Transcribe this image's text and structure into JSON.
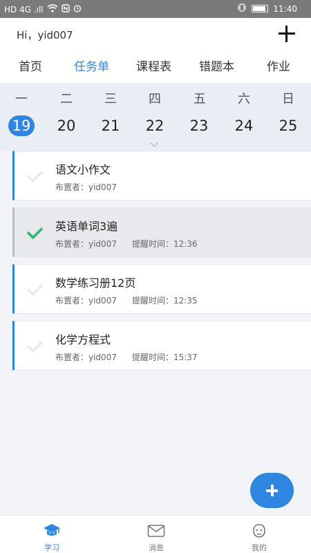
{
  "statusbar": {
    "left": "HD 4G .ıll",
    "time": "11:40"
  },
  "header": {
    "greeting": "Hi，yid007"
  },
  "tabs": [
    "首页",
    "任务单",
    "课程表",
    "错题本",
    "作业"
  ],
  "week": {
    "days": [
      "一",
      "二",
      "三",
      "四",
      "五",
      "六",
      "日"
    ],
    "dates": [
      "19",
      "20",
      "21",
      "22",
      "23",
      "24",
      "25"
    ],
    "selected_index": 0
  },
  "tasks": [
    {
      "title": "语文小作文",
      "assigner": "布置者：yid007",
      "remind": "",
      "done": false
    },
    {
      "title": "英语单词3遍",
      "assigner": "布置者：yid007",
      "remind": "提醒时间：12:36",
      "done": true
    },
    {
      "title": "数学练习册12页",
      "assigner": "布置者：yid007",
      "remind": "提醒时间：12:35",
      "done": false
    },
    {
      "title": "化学方程式",
      "assigner": "布置者：yid007",
      "remind": "提醒时间：15:37",
      "done": false
    }
  ],
  "nav": [
    {
      "label": "学习",
      "icon": "graduation-cap-icon",
      "active": true
    },
    {
      "label": "消息",
      "icon": "mail-icon",
      "active": false
    },
    {
      "label": "我的",
      "icon": "robot-face-icon",
      "active": false
    }
  ],
  "colors": {
    "accent": "#2f86e0",
    "done_check": "#3bb57b"
  }
}
